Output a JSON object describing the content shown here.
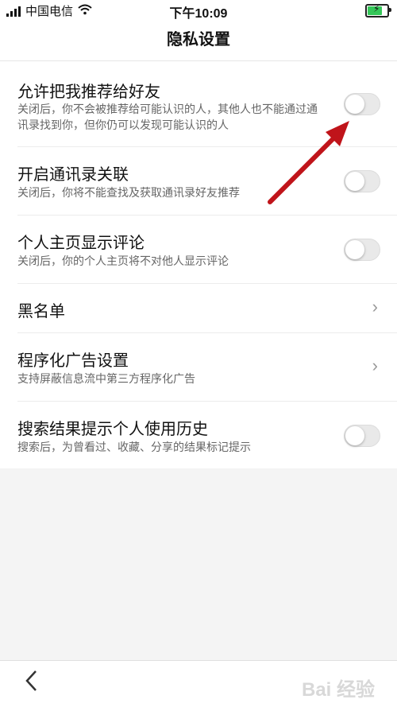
{
  "status_bar": {
    "carrier": "中国电信",
    "time": "下午10:09",
    "battery_icon": "charging-battery-icon"
  },
  "nav": {
    "title": "隐私设置"
  },
  "settings": [
    {
      "title": "允许把我推荐给好友",
      "desc": "关闭后，你不会被推荐给可能认识的人，其他人也不能通过通讯录找到你，但你仍可以发现可能认识的人",
      "control": "toggle",
      "on": false
    },
    {
      "title": "开启通讯录关联",
      "desc": "关闭后，你将不能查找及获取通讯录好友推荐",
      "control": "toggle",
      "on": false
    },
    {
      "title": "个人主页显示评论",
      "desc": "关闭后，你的个人主页将不对他人显示评论",
      "control": "toggle",
      "on": false
    },
    {
      "title": "黑名单",
      "desc": "",
      "control": "chevron"
    },
    {
      "title": "程序化广告设置",
      "desc": "支持屏蔽信息流中第三方程序化广告",
      "control": "chevron"
    },
    {
      "title": "搜索结果提示个人使用历史",
      "desc": "搜索后，为曾看过、收藏、分享的结果标记提示",
      "control": "toggle",
      "on": false
    }
  ],
  "annotation": {
    "color": "#c0141a"
  },
  "bottom_bar": {
    "back_icon": "chevron-left-icon",
    "watermark": "Bai 经验"
  }
}
